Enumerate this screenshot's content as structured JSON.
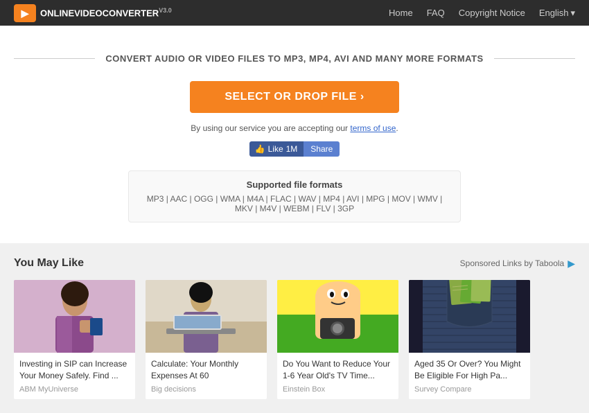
{
  "header": {
    "logo_text": "OnlineVideoConverter",
    "logo_version": "v3.0",
    "nav": {
      "home": "Home",
      "faq": "FAQ",
      "copyright": "Copyright Notice",
      "language": "English"
    }
  },
  "main": {
    "tagline": "CONVERT AUDIO OR VIDEO FILES TO MP3, MP4, AVI AND MANY MORE FORMATS",
    "select_button": "SELECT OR DROP FILE  ›",
    "terms_prefix": "By using our service you are accepting our ",
    "terms_link": "terms of use",
    "facebook": {
      "like": "Like",
      "count": "1M",
      "share": "Share"
    },
    "formats": {
      "title": "Supported file formats",
      "list": "MP3 | AAC | OGG | WMA | M4A | FLAC | WAV | MP4 | AVI | MPG | MOV | WMV | MKV | M4V | WEBM | FLV | 3GP"
    }
  },
  "recommendations": {
    "title": "You May Like",
    "sponsored": "Sponsored Links by Taboola",
    "cards": [
      {
        "title": "Investing in SIP can Increase Your Money Safely. Find ...",
        "source": "ABM MyUniverse"
      },
      {
        "title": "Calculate: Your Monthly Expenses At 60",
        "source": "Big decisions"
      },
      {
        "title": "Do You Want to Reduce Your 1-6 Year Old's TV Time...",
        "source": "Einstein Box"
      },
      {
        "title": "Aged 35 Or Over? You Might Be Eligible For High Pa...",
        "source": "Survey Compare"
      }
    ]
  }
}
